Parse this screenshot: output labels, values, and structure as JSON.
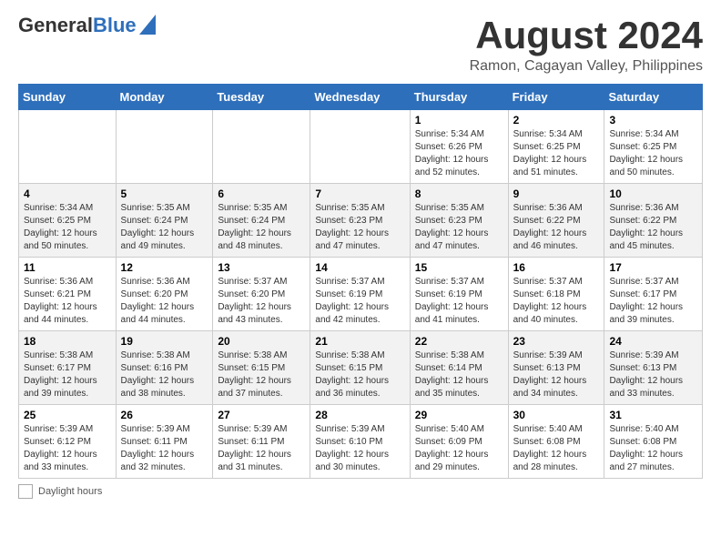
{
  "header": {
    "logo_general": "General",
    "logo_blue": "Blue",
    "main_title": "August 2024",
    "subtitle": "Ramon, Cagayan Valley, Philippines"
  },
  "weekdays": [
    "Sunday",
    "Monday",
    "Tuesday",
    "Wednesday",
    "Thursday",
    "Friday",
    "Saturday"
  ],
  "weeks": [
    [
      {
        "day": "",
        "info": ""
      },
      {
        "day": "",
        "info": ""
      },
      {
        "day": "",
        "info": ""
      },
      {
        "day": "",
        "info": ""
      },
      {
        "day": "1",
        "info": "Sunrise: 5:34 AM\nSunset: 6:26 PM\nDaylight: 12 hours\nand 52 minutes."
      },
      {
        "day": "2",
        "info": "Sunrise: 5:34 AM\nSunset: 6:25 PM\nDaylight: 12 hours\nand 51 minutes."
      },
      {
        "day": "3",
        "info": "Sunrise: 5:34 AM\nSunset: 6:25 PM\nDaylight: 12 hours\nand 50 minutes."
      }
    ],
    [
      {
        "day": "4",
        "info": "Sunrise: 5:34 AM\nSunset: 6:25 PM\nDaylight: 12 hours\nand 50 minutes."
      },
      {
        "day": "5",
        "info": "Sunrise: 5:35 AM\nSunset: 6:24 PM\nDaylight: 12 hours\nand 49 minutes."
      },
      {
        "day": "6",
        "info": "Sunrise: 5:35 AM\nSunset: 6:24 PM\nDaylight: 12 hours\nand 48 minutes."
      },
      {
        "day": "7",
        "info": "Sunrise: 5:35 AM\nSunset: 6:23 PM\nDaylight: 12 hours\nand 47 minutes."
      },
      {
        "day": "8",
        "info": "Sunrise: 5:35 AM\nSunset: 6:23 PM\nDaylight: 12 hours\nand 47 minutes."
      },
      {
        "day": "9",
        "info": "Sunrise: 5:36 AM\nSunset: 6:22 PM\nDaylight: 12 hours\nand 46 minutes."
      },
      {
        "day": "10",
        "info": "Sunrise: 5:36 AM\nSunset: 6:22 PM\nDaylight: 12 hours\nand 45 minutes."
      }
    ],
    [
      {
        "day": "11",
        "info": "Sunrise: 5:36 AM\nSunset: 6:21 PM\nDaylight: 12 hours\nand 44 minutes."
      },
      {
        "day": "12",
        "info": "Sunrise: 5:36 AM\nSunset: 6:20 PM\nDaylight: 12 hours\nand 44 minutes."
      },
      {
        "day": "13",
        "info": "Sunrise: 5:37 AM\nSunset: 6:20 PM\nDaylight: 12 hours\nand 43 minutes."
      },
      {
        "day": "14",
        "info": "Sunrise: 5:37 AM\nSunset: 6:19 PM\nDaylight: 12 hours\nand 42 minutes."
      },
      {
        "day": "15",
        "info": "Sunrise: 5:37 AM\nSunset: 6:19 PM\nDaylight: 12 hours\nand 41 minutes."
      },
      {
        "day": "16",
        "info": "Sunrise: 5:37 AM\nSunset: 6:18 PM\nDaylight: 12 hours\nand 40 minutes."
      },
      {
        "day": "17",
        "info": "Sunrise: 5:37 AM\nSunset: 6:17 PM\nDaylight: 12 hours\nand 39 minutes."
      }
    ],
    [
      {
        "day": "18",
        "info": "Sunrise: 5:38 AM\nSunset: 6:17 PM\nDaylight: 12 hours\nand 39 minutes."
      },
      {
        "day": "19",
        "info": "Sunrise: 5:38 AM\nSunset: 6:16 PM\nDaylight: 12 hours\nand 38 minutes."
      },
      {
        "day": "20",
        "info": "Sunrise: 5:38 AM\nSunset: 6:15 PM\nDaylight: 12 hours\nand 37 minutes."
      },
      {
        "day": "21",
        "info": "Sunrise: 5:38 AM\nSunset: 6:15 PM\nDaylight: 12 hours\nand 36 minutes."
      },
      {
        "day": "22",
        "info": "Sunrise: 5:38 AM\nSunset: 6:14 PM\nDaylight: 12 hours\nand 35 minutes."
      },
      {
        "day": "23",
        "info": "Sunrise: 5:39 AM\nSunset: 6:13 PM\nDaylight: 12 hours\nand 34 minutes."
      },
      {
        "day": "24",
        "info": "Sunrise: 5:39 AM\nSunset: 6:13 PM\nDaylight: 12 hours\nand 33 minutes."
      }
    ],
    [
      {
        "day": "25",
        "info": "Sunrise: 5:39 AM\nSunset: 6:12 PM\nDaylight: 12 hours\nand 33 minutes."
      },
      {
        "day": "26",
        "info": "Sunrise: 5:39 AM\nSunset: 6:11 PM\nDaylight: 12 hours\nand 32 minutes."
      },
      {
        "day": "27",
        "info": "Sunrise: 5:39 AM\nSunset: 6:11 PM\nDaylight: 12 hours\nand 31 minutes."
      },
      {
        "day": "28",
        "info": "Sunrise: 5:39 AM\nSunset: 6:10 PM\nDaylight: 12 hours\nand 30 minutes."
      },
      {
        "day": "29",
        "info": "Sunrise: 5:40 AM\nSunset: 6:09 PM\nDaylight: 12 hours\nand 29 minutes."
      },
      {
        "day": "30",
        "info": "Sunrise: 5:40 AM\nSunset: 6:08 PM\nDaylight: 12 hours\nand 28 minutes."
      },
      {
        "day": "31",
        "info": "Sunrise: 5:40 AM\nSunset: 6:08 PM\nDaylight: 12 hours\nand 27 minutes."
      }
    ]
  ],
  "footer": {
    "daylight_label": "Daylight hours"
  }
}
